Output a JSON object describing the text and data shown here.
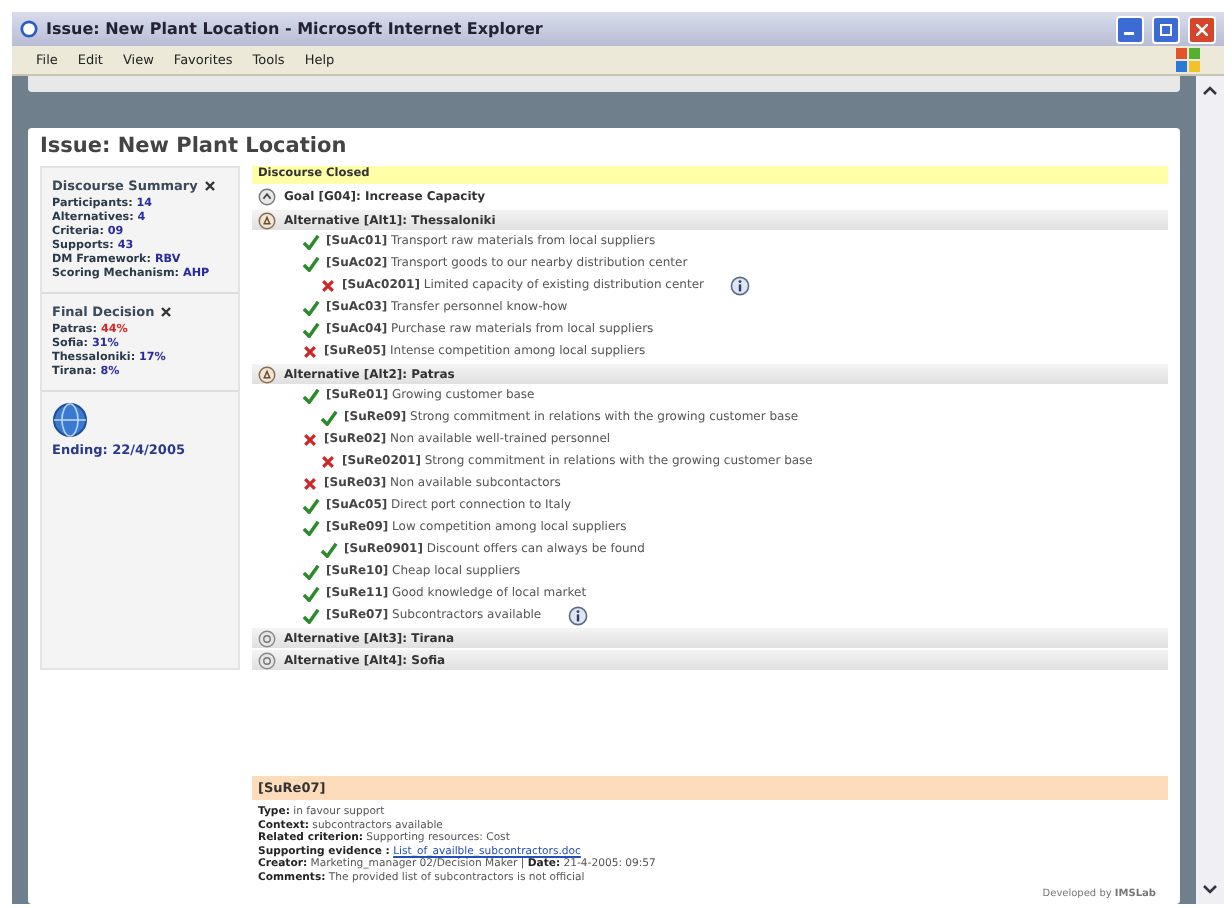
{
  "window": {
    "title": "Issue: New Plant Location - Microsoft Internet Explorer"
  },
  "menu": [
    "File",
    "Edit",
    "View",
    "Favorites",
    "Tools",
    "Help"
  ],
  "page_title": "Issue: New Plant Location",
  "summary": {
    "title": "Discourse Summary",
    "rows": [
      {
        "label": "Participants:",
        "value": "14"
      },
      {
        "label": "Alternatives:",
        "value": "4"
      },
      {
        "label": "Criteria:",
        "value": "09"
      },
      {
        "label": "Supports:",
        "value": "43"
      },
      {
        "label": "DM Framework:",
        "value": "RBV"
      },
      {
        "label": "Scoring Mechanism:",
        "value": "AHP"
      }
    ]
  },
  "final_decision": {
    "title": "Final Decision",
    "rows": [
      {
        "label": "Patras:",
        "value": "44%",
        "color": "#e02020"
      },
      {
        "label": "Sofia:",
        "value": "31%",
        "color": "#2a2aa0"
      },
      {
        "label": "Thessaloniki:",
        "value": "17%",
        "color": "#2a2aa0"
      },
      {
        "label": "Tirana:",
        "value": "8%",
        "color": "#2a2aa0"
      }
    ]
  },
  "ending": "Ending: 22/4/2005",
  "status": "Discourse Closed",
  "goal": "Goal [G04]: Increase Capacity",
  "alternatives": [
    {
      "label": "Alternative [Alt1]: Thessaloniki",
      "expanded": true,
      "children": [
        {
          "kind": "pro",
          "code": "[SuAc01]",
          "text": "Transport raw materials from local suppliers",
          "info": false
        },
        {
          "kind": "pro",
          "code": "[SuAc02]",
          "text": "Transport goods to our nearby distribution center",
          "info": false,
          "children": [
            {
              "kind": "con",
              "code": "[SuAc0201]",
              "text": "Limited capacity of existing distribution center",
              "info": true
            }
          ]
        },
        {
          "kind": "pro",
          "code": "[SuAc03]",
          "text": "Transfer personnel know-how",
          "info": false
        },
        {
          "kind": "pro",
          "code": "[SuAc04]",
          "text": "Purchase raw materials from local suppliers",
          "info": false
        },
        {
          "kind": "con",
          "code": "[SuRe05]",
          "text": "Intense competition among local suppliers",
          "info": false
        }
      ]
    },
    {
      "label": "Alternative [Alt2]: Patras",
      "expanded": true,
      "children": [
        {
          "kind": "pro",
          "code": "[SuRe01]",
          "text": "Growing customer base",
          "info": false,
          "children": [
            {
              "kind": "pro",
              "code": "[SuRe09]",
              "text": "Strong commitment in relations with the growing customer base",
              "info": false
            }
          ]
        },
        {
          "kind": "con",
          "code": "[SuRe02]",
          "text": "Non available well-trained personnel",
          "info": false,
          "children": [
            {
              "kind": "con",
              "code": "[SuRe0201]",
              "text": "Strong commitment in relations with the growing customer base",
              "info": false
            }
          ]
        },
        {
          "kind": "con",
          "code": "[SuRe03]",
          "text": "Non available subcontactors",
          "info": false
        },
        {
          "kind": "pro",
          "code": "[SuAc05]",
          "text": "Direct port connection to Italy",
          "info": false
        },
        {
          "kind": "pro",
          "code": "[SuRe09]",
          "text": "Low competition among local suppliers",
          "info": false,
          "children": [
            {
              "kind": "pro",
              "code": "[SuRe0901]",
              "text": "Discount offers can always be found",
              "info": false
            }
          ]
        },
        {
          "kind": "pro",
          "code": "[SuRe10]",
          "text": "Cheap local suppliers",
          "info": false
        },
        {
          "kind": "pro",
          "code": "[SuRe11]",
          "text": "Good knowledge of local market",
          "info": false
        },
        {
          "kind": "pro",
          "code": "[SuRe07]",
          "text": "Subcontractors available",
          "info": true
        }
      ]
    },
    {
      "label": "Alternative [Alt3]: Tirana",
      "expanded": false
    },
    {
      "label": "Alternative [Alt4]: Sofia",
      "expanded": false
    }
  ],
  "detail": {
    "title": "[SuRe07]",
    "lines": [
      {
        "kind": "text",
        "label": "Type:",
        "value": "in favour support"
      },
      {
        "kind": "text",
        "label": "Context:",
        "value": "subcontractors available"
      },
      {
        "kind": "text",
        "label": "Related criterion:",
        "value": "Supporting resources: Cost"
      },
      {
        "kind": "link",
        "label": "Supporting evidence :",
        "value": "List_of_availble_subcontractors.doc"
      },
      {
        "kind": "creator",
        "label": "Creator:",
        "value": "Marketing_manager 02/Decision Maker",
        "separator": "|",
        "label2": "Date:",
        "value2": "21-4-2005: 09:57"
      },
      {
        "kind": "text",
        "label": "Comments:",
        "value": "The provided list of subcontractors is not official"
      }
    ]
  },
  "footer": {
    "prefix": "Developed by",
    "brand": "IMSLab"
  }
}
